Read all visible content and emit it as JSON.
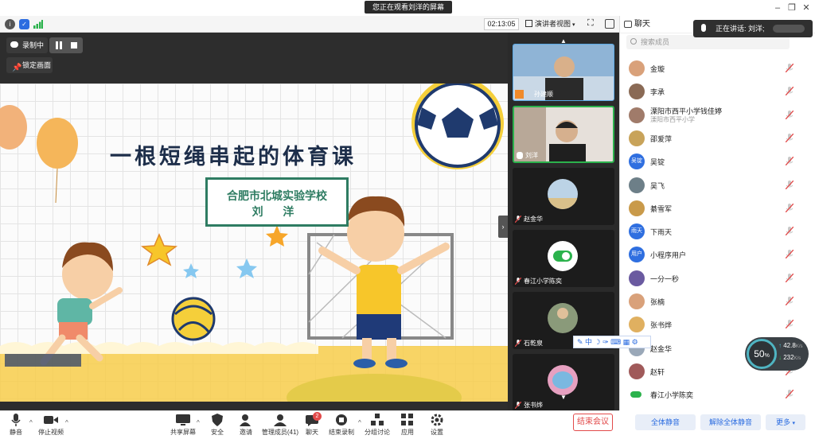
{
  "window": {
    "banner": "您正在观看刘洋的屏幕"
  },
  "status_bar": {
    "timer": "02:13:05",
    "view_mode": "演讲者视图"
  },
  "recording": {
    "label": "录制中",
    "pin_label": "锁定画面"
  },
  "slide": {
    "title": "一根短绳串起的体育课",
    "school": "合肥市北城实验学校",
    "teacher": "刘 洋"
  },
  "video_tiles": [
    {
      "name": "孙建顺"
    },
    {
      "name": "刘洋"
    },
    {
      "name": "赵金华"
    },
    {
      "name": "春江小学陈奕"
    },
    {
      "name": "石乾泉"
    },
    {
      "name": "张书烨"
    }
  ],
  "sidebar": {
    "title": "聊天",
    "search_placeholder": "搜索成员",
    "speaking": "正在讲话: 刘洋;",
    "members": [
      {
        "name": "金璇",
        "avatar": "",
        "color": "#d9a17a"
      },
      {
        "name": "李承",
        "avatar": "",
        "color": "#8a6a55"
      },
      {
        "name": "溧阳市西平小学钱佳婷",
        "sub": "溧阳市西平小学",
        "avatar": "",
        "color": "#a07b6a"
      },
      {
        "name": "邵爱萍",
        "avatar": "",
        "color": "#c8a35a"
      },
      {
        "name": "吴锭",
        "avatar": "吴锭",
        "color": "#2f6fe0"
      },
      {
        "name": "吴飞",
        "avatar": "",
        "color": "#6d7f88"
      },
      {
        "name": "綦雪军",
        "avatar": "",
        "color": "#c99a4a"
      },
      {
        "name": "下雨天",
        "avatar": "雨天",
        "color": "#2f6fe0"
      },
      {
        "name": "小程序用户",
        "avatar": "用户",
        "color": "#2f6fe0"
      },
      {
        "name": "一分一秒",
        "avatar": "",
        "color": "#6a5aa0"
      },
      {
        "name": "张楠",
        "avatar": "",
        "color": "#d9a17a"
      },
      {
        "name": "张书烨",
        "avatar": "",
        "color": "#e0b060"
      },
      {
        "name": "赵金华",
        "avatar": "",
        "color": "#9aa8b8"
      },
      {
        "name": "赵轩",
        "avatar": "",
        "color": "#a05a5a"
      },
      {
        "name": "春江小学陈奕",
        "avatar": "",
        "color": "#ffffff"
      }
    ],
    "mute_all": "全体静音",
    "unmute_all": "解除全体静音",
    "more": "更多"
  },
  "network": {
    "percent": "50",
    "percent_unit": "%",
    "upload": "42.8",
    "upload_unit": "K/s",
    "download": "232",
    "download_unit": "K/s"
  },
  "toolbar": {
    "mute": "静音",
    "stop_video": "停止视频",
    "share_screen": "共享屏幕",
    "security": "安全",
    "invite": "邀请",
    "manage_members": "管理成员(41)",
    "chat": "聊天",
    "chat_badge": "2",
    "end_recording": "结束录制",
    "breakout": "分组讨论",
    "apps": "应用",
    "settings": "设置",
    "end_meeting": "结束会议"
  },
  "colors": {
    "accent": "#2b6ce0",
    "danger": "#e24a4a",
    "mute_red": "#e24a4a"
  }
}
